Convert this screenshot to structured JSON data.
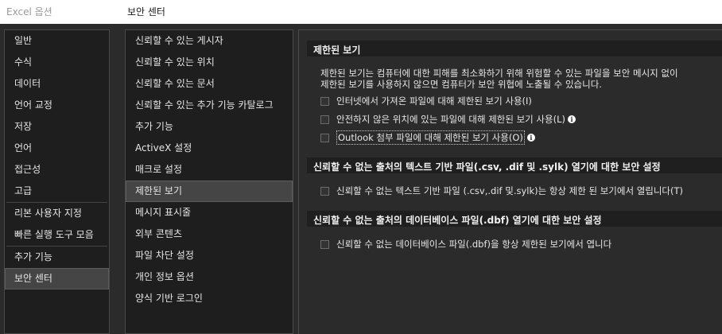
{
  "window": {
    "left_title": "Excel 옵션",
    "right_title": "보안 센터"
  },
  "outer_nav": {
    "items": [
      "일반",
      "수식",
      "데이터",
      "언어 교정",
      "저장",
      "언어",
      "접근성",
      "고급",
      "리본 사용자 지정",
      "빠른 실행 도구 모음",
      "추가 기능",
      "보안 센터"
    ],
    "selected": "보안 센터"
  },
  "inner_nav": {
    "items": [
      "신뢰할 수 있는 게시자",
      "신뢰할 수 있는 위치",
      "신뢰할 수 있는 문서",
      "신뢰할 수 있는 추가 기능 카탈로그",
      "추가 기능",
      "ActiveX 설정",
      "매크로 설정",
      "제한된 보기",
      "메시지 표시줄",
      "외부 콘텐츠",
      "파일 차단 설정",
      "개인 정보 옵션",
      "양식 기반 로그인"
    ],
    "selected": "제한된 보기"
  },
  "protected_view": {
    "header": "제한된 보기",
    "desc_line1": "제한된 보기는 컴퓨터에 대한 피해를 최소화하기 위해 위험할 수 있는 파일을 보안 메시지 없이",
    "desc_line2": "제한된 보기를 사용하지 않으면 컴퓨터가 보안 위협에 노출될 수 있습니다.",
    "opt_internet": "인터넷에서 가져온 파일에 대해 제한된 보기 사용(I)",
    "opt_unsafe": "안전하지 않은 위치에 있는 파일에 대해 제한된 보기 사용(L)",
    "opt_outlook": "Outlook 첨부 파일에 대해 제한된 보기 사용(O)"
  },
  "text_files": {
    "header": "신뢰할 수 없는 출처의 텍스트 기반 파일(.csv, .dif 및 .sylk) 열기에 대한 보안 설정",
    "option": "신뢰할 수 없는 텍스트 기반 파일 (.csv,.dif 및.sylk)는 항상 제한 된 보기에서 열립니다(T)"
  },
  "dbf_files": {
    "header": "신뢰할 수 없는 출처의 데이터베이스 파일(.dbf) 열기에 대한 보안 설정",
    "option": "신뢰할 수 없는 데이터베이스 파일(.dbf)을 항상 제한된 보기에서 엽니다"
  },
  "icons": {
    "info": "info-icon",
    "checkbox": "checkbox-unchecked"
  }
}
